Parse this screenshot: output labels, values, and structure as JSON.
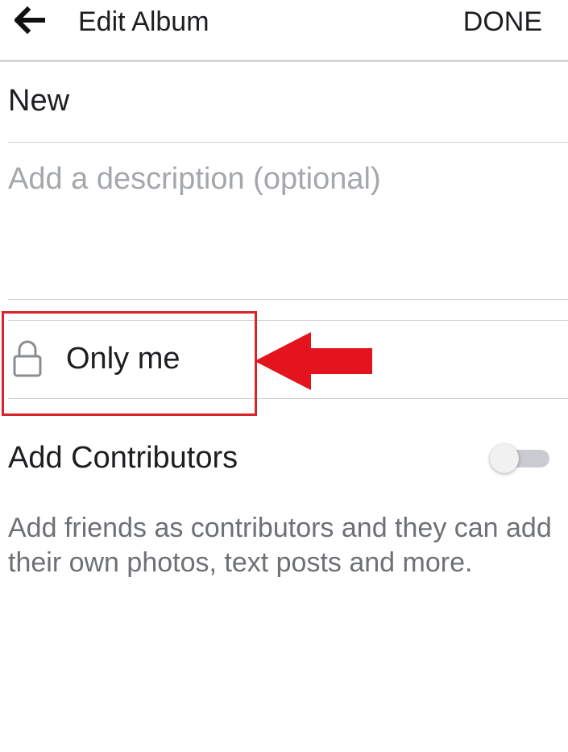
{
  "header": {
    "back_icon": "arrow-left-icon",
    "title": "Edit Album",
    "done_label": "DONE"
  },
  "album": {
    "name": "New",
    "description_placeholder": "Add a description (optional)"
  },
  "privacy": {
    "icon": "lock-icon",
    "label": "Only me"
  },
  "contributors": {
    "label": "Add Contributors",
    "toggle_on": false,
    "description": "Add friends as contributors and they can add their own photos, text posts and more."
  },
  "annotation": {
    "color": "#e3141e",
    "highlight": "privacy-row"
  }
}
